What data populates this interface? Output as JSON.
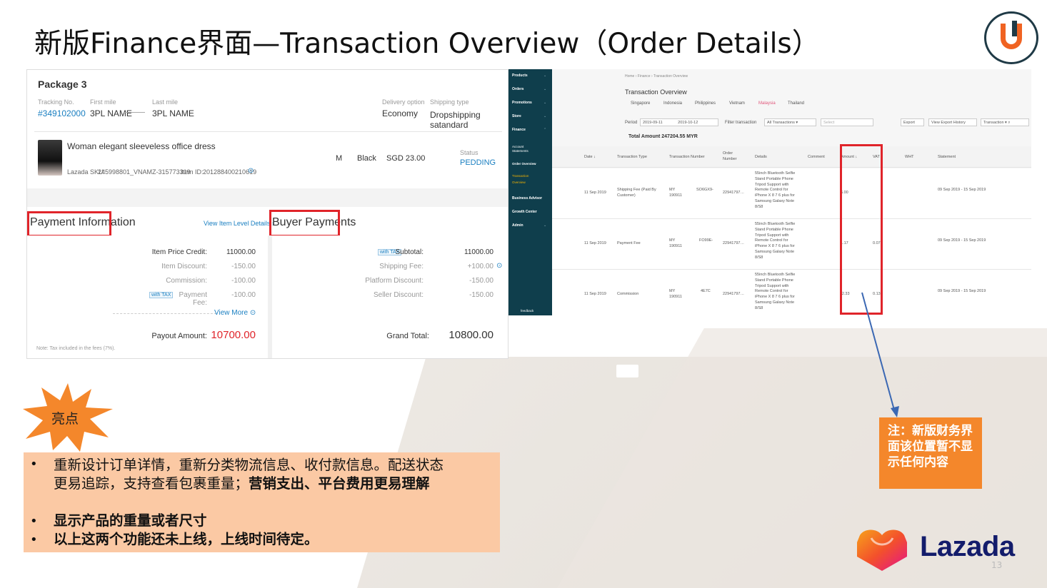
{
  "slide": {
    "title": "新版Finance界面—Transaction Overview（Order Details）",
    "page_number": "13"
  },
  "package": {
    "title": "Package 3",
    "tracking_label": "Tracking No.",
    "tracking_value": "#349102000",
    "first_mile_label": "First mile",
    "first_mile_value": "3PL NAME",
    "last_mile_label": "Last mile",
    "last_mile_value": "3PL NAME",
    "delivery_label": "Delivery option",
    "delivery_value": "Economy",
    "shipping_label": "Shipping type",
    "shipping_value": "Dropshipping satandard",
    "product_name": "Woman elegant sleeveless office dress",
    "sku_label": "Lazada SKU:",
    "sku_value": "245998801_VNAMZ-315773319",
    "item_id_label": "Item ID:",
    "item_id_value": "201288400210619",
    "size": "M",
    "color": "Black",
    "price": "SGD 23.00",
    "status_label": "Status",
    "status_value": "PEDDING"
  },
  "payment_info": {
    "label": "Payment Information",
    "view_item_link": "View Item Level Details",
    "rows": [
      {
        "label": "Item Price Credit:",
        "value": "11000.00"
      },
      {
        "label": "Item Discount:",
        "value": "-150.00"
      },
      {
        "label": "Commission:",
        "value": "-100.00"
      },
      {
        "label": "Payment Fee:",
        "value": "-100.00"
      }
    ],
    "tax_tag": "with TAX",
    "view_more": "View More",
    "payout_label": "Payout Amount:",
    "payout_value": "10700.00",
    "note": "Note: Tax included in the fees (7%)."
  },
  "buyer_payments": {
    "label": "Buyer Payments",
    "tax_tag": "with TAX",
    "rows": [
      {
        "label": "Subtotal:",
        "value": "11000.00"
      },
      {
        "label": "Shipping Fee:",
        "value": "+100.00"
      },
      {
        "label": "Platform Discount:",
        "value": "-150.00"
      },
      {
        "label": "Seller Discount:",
        "value": "-150.00"
      }
    ],
    "grand_label": "Grand Total:",
    "grand_value": "10800.00"
  },
  "seller_center": {
    "sidebar": {
      "items": [
        "Products",
        "Orders",
        "Promotions",
        "Store",
        "Finance"
      ],
      "finance_sub": [
        "Account Statements",
        "Order Overview",
        "Transaction Overview"
      ],
      "items_after": [
        "Business Advisor",
        "Growth Center",
        "Admin"
      ],
      "feedback": "feedback"
    },
    "breadcrumb": [
      "Home",
      "Finance",
      "Transaction Overview"
    ],
    "title": "Transaction Overview",
    "countries": [
      "Singapore",
      "Indonesia",
      "Philippines",
      "Vietnam",
      "Malaysia",
      "Thailand"
    ],
    "active_country": "Malaysia",
    "period_label": "Period",
    "period_start": "2019-09-11",
    "period_end": "2019-10-12",
    "filter_label": "Filter transaction",
    "filter_value": "All Transactions",
    "select_placeholder": "Select",
    "export_btn": "Export",
    "history_btn": "View Export History",
    "search_placeholder": "Transaction",
    "total_amount": "Total Amount 247204.55 MYR",
    "columns": [
      "Date ↓",
      "Transaction Type",
      "Transaction Number",
      "Order Number",
      "Details",
      "Comment",
      "Amount ↓",
      "VAT",
      "WHT",
      "Statement"
    ],
    "rows": [
      {
        "date": "11 Sep 2019",
        "type": "Shipping Fee (Paid By Customer)",
        "txn_a": "MY",
        "txn_b": "190911",
        "txn_c": "SO6GX9-",
        "order": "22941797…",
        "details": "55inch Bluetooth Selfie Stand Portable Phone Tripod Support with Remote Control for iPhone X 8 7 6 plus for Samsung Galaxy Note 8/S8",
        "amount": "6.00",
        "vat": "",
        "statement": "09 Sep 2019 - 15 Sep 2019"
      },
      {
        "date": "11 Sep 2019",
        "type": "Payment Fee",
        "txn_a": "MY",
        "txn_b": "190911",
        "txn_c": "FO99E-",
        "order": "22941797…",
        "details": "55inch Bluetooth Selfie Stand Portable Phone Tripod Support with Remote Control for iPhone X 8 7 6 plus for Samsung Galaxy Note 8/S8",
        "amount": "1.17",
        "vat": "0.07",
        "statement": "09 Sep 2019 - 15 Sep 2019"
      },
      {
        "date": "11 Sep 2019",
        "type": "Commission",
        "txn_a": "MY",
        "txn_b": "190911",
        "txn_c": "4E7C",
        "order": "22941797…",
        "details": "55inch Bluetooth Selfie Stand Portable Phone Tripod Support with Remote Control for iPhone X 8 7 6 plus for Samsung Galaxy Note 8/S8",
        "amount": "-2.33",
        "vat": "0.13",
        "statement": "09 Sep 2019 - 15 Sep 2019"
      }
    ]
  },
  "note_box": "注：新版财务界面该位置暂不显示任何内容",
  "highlight": {
    "badge": "亮点",
    "line1": "重新设计订单详情，重新分类物流信息、收付款信息。配送状态",
    "line2_normal": "更易追踪，支持查看包裹重量；",
    "line2_bold": "营销支出、平台费用更易理解",
    "line3": "显示产品的重量或者尺寸",
    "line4": "以上这两个功能还未上线，上线时间待定。"
  },
  "brand": {
    "name": "Lazada",
    "accent": "#f4872b",
    "red": "#e0242a",
    "navy": "#0f3e4c"
  }
}
